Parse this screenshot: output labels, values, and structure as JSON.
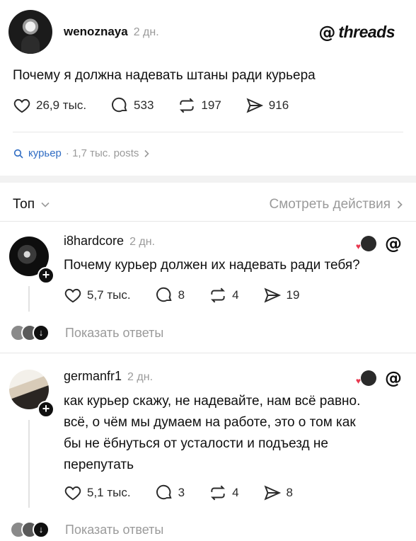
{
  "post": {
    "username": "wenoznaya",
    "time": "2 дн.",
    "brand": "threads",
    "text": "Почему я должна надевать штаны ради курьера",
    "likes": "26,9 тыс.",
    "comments": "533",
    "reposts": "197",
    "shares": "916"
  },
  "tag": {
    "name": "курьер",
    "meta": "· 1,7 тыс. posts"
  },
  "sort": {
    "label": "Топ",
    "link": "Смотреть действия"
  },
  "replies": [
    {
      "username": "i8hardcore",
      "time": "2 дн.",
      "text": "Почему курьер должен их надевать ради тебя?",
      "likes": "5,7 тыс.",
      "comments": "8",
      "reposts": "4",
      "shares": "19",
      "show_replies": "Показать ответы"
    },
    {
      "username": "germanfr1",
      "time": "2 дн.",
      "text_lines": [
        "как курьер скажу, не надевайте, нам всё равно.",
        "всё, о чём мы думаем на работе, это о том как",
        "бы не ёбнуться от усталости и подъезд не",
        "перепутать"
      ],
      "likes": "5,1 тыс.",
      "comments": "3",
      "reposts": "4",
      "shares": "8",
      "show_replies": "Показать ответы"
    }
  ],
  "icons": {
    "like": "heart-icon",
    "comment": "comment-icon",
    "repost": "repost-icon",
    "share": "send-icon",
    "search": "search-icon",
    "chevron_down": "chevron-down-icon",
    "chevron_right": "chevron-right-icon",
    "threads": "threads-logo-icon"
  },
  "colors": {
    "tag_link": "#2f6cc3",
    "muted": "#9a9a9a",
    "heart_red": "#e8384f"
  }
}
